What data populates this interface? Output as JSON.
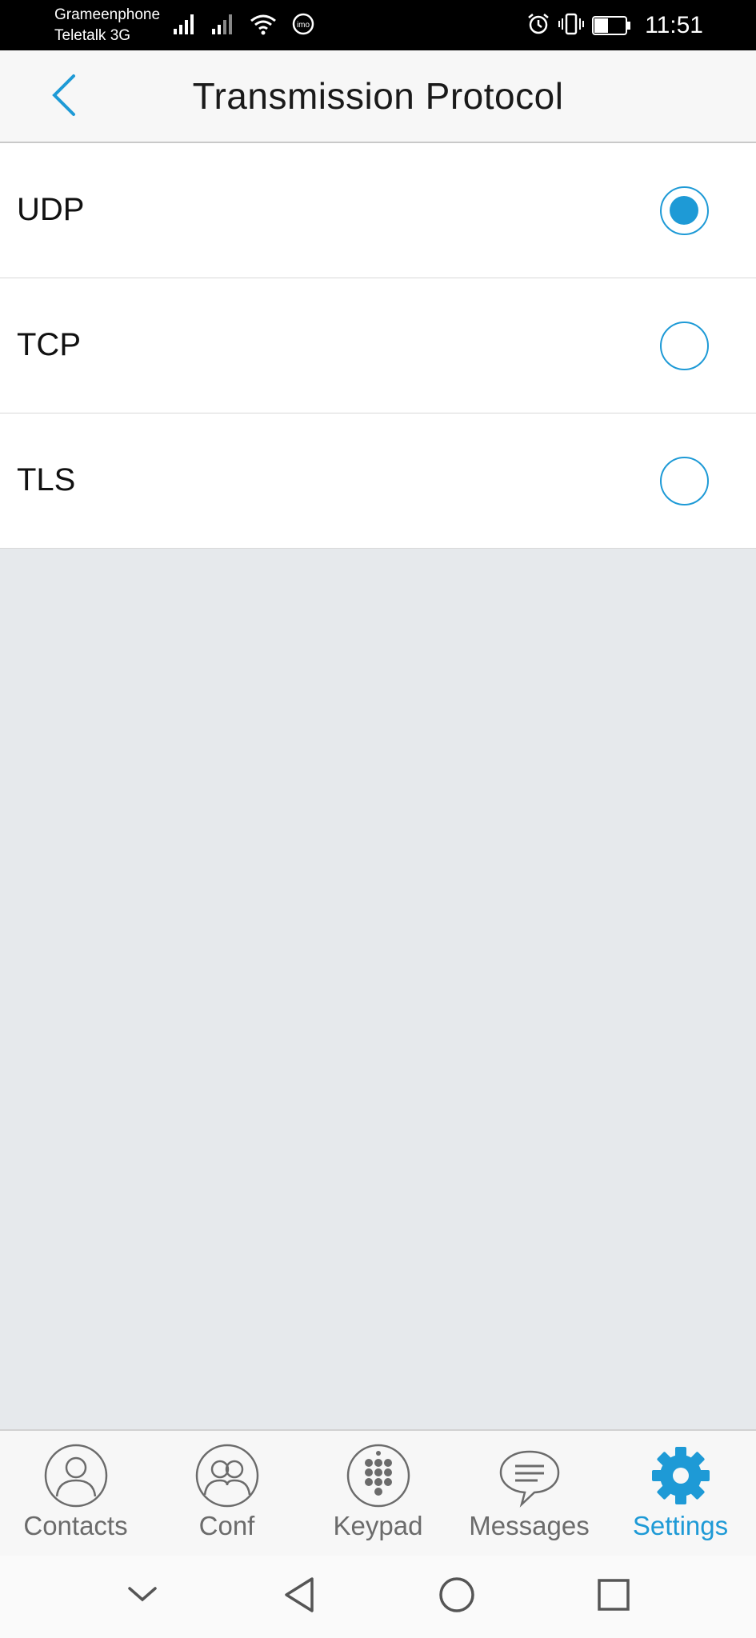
{
  "status_bar": {
    "carrier_1": "Grameenphone",
    "carrier_2": "Teletalk 3G",
    "battery": "41",
    "time": "11:51",
    "icons": [
      "signal-icon",
      "signal-icon",
      "wifi-icon",
      "imo-icon",
      "alarm-icon",
      "vibrate-icon",
      "battery-icon"
    ],
    "imo_label": "imo"
  },
  "header": {
    "title": "Transmission Protocol",
    "back_icon": "chevron-left-icon"
  },
  "options": [
    {
      "label": "UDP",
      "selected": true
    },
    {
      "label": "TCP",
      "selected": false
    },
    {
      "label": "TLS",
      "selected": false
    }
  ],
  "tabs": [
    {
      "label": "Contacts",
      "icon": "contacts-icon",
      "active": false
    },
    {
      "label": "Conf",
      "icon": "conference-icon",
      "active": false
    },
    {
      "label": "Keypad",
      "icon": "keypad-icon",
      "active": false
    },
    {
      "label": "Messages",
      "icon": "messages-icon",
      "active": false
    },
    {
      "label": "Settings",
      "icon": "gear-icon",
      "active": true
    }
  ],
  "nav": [
    "collapse-icon",
    "back-icon",
    "home-icon",
    "recents-icon"
  ],
  "colors": {
    "accent": "#1e9ad6",
    "tab_inactive": "#6b6b6b",
    "background": "#e6e9ec"
  }
}
